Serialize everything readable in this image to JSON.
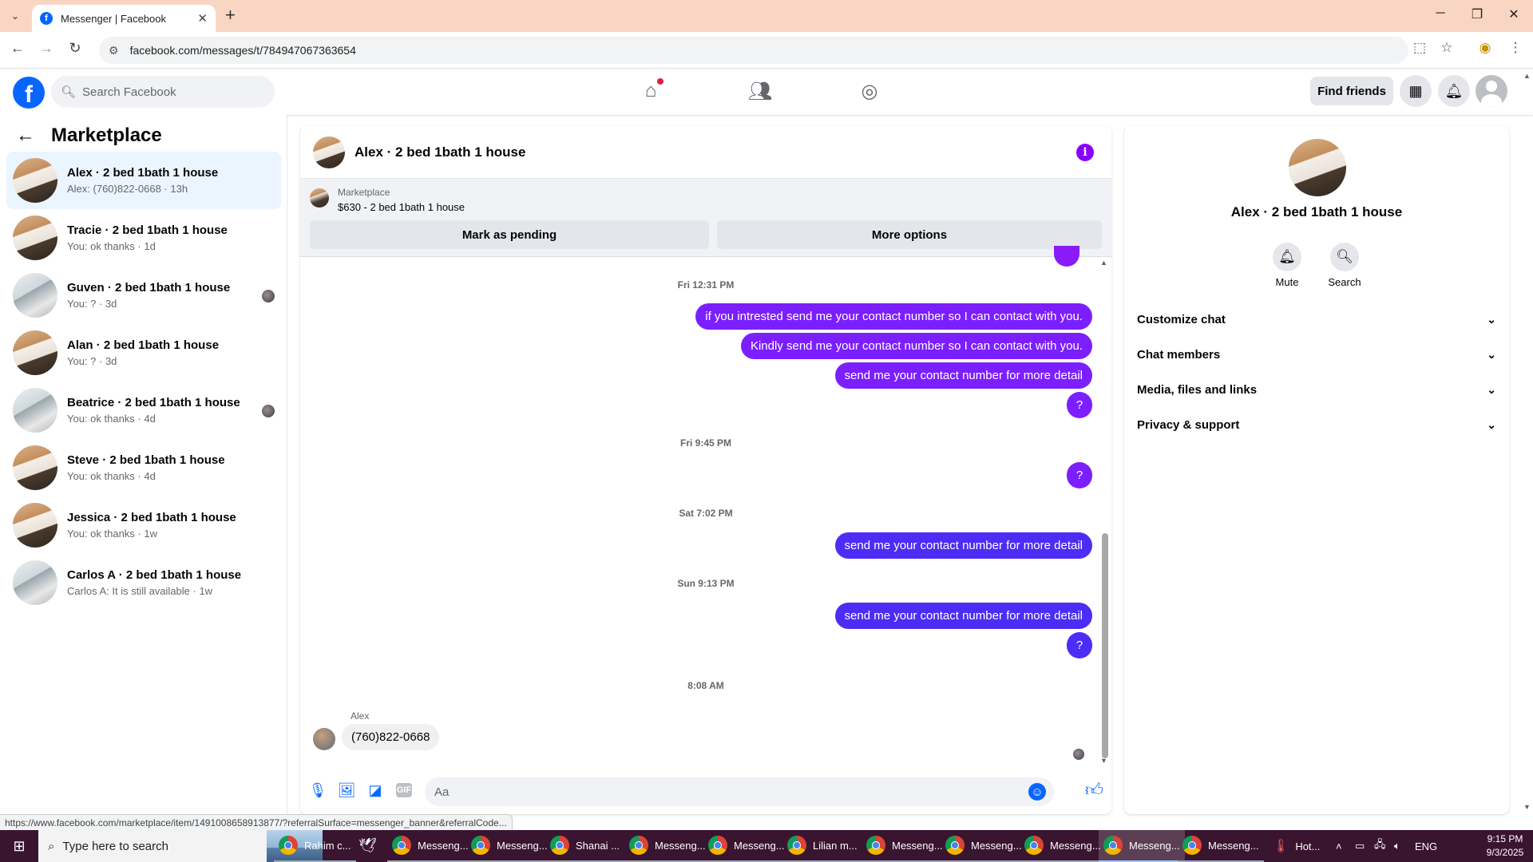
{
  "browser": {
    "tab_title": "Messenger | Facebook",
    "url": "facebook.com/messages/t/784947067363654",
    "status_url": "https://www.facebook.com/marketplace/item/1491008658913877/?referralSurface=messenger_banner&referralCode..."
  },
  "fb_header": {
    "search_placeholder": "Search Facebook",
    "find_friends": "Find friends"
  },
  "sidebar": {
    "title": "Marketplace",
    "conversations": [
      {
        "name": "Alex · 2 bed 1bath 1 house",
        "preview": "Alex: (760)822-0668 · 13h"
      },
      {
        "name": "Tracie · 2 bed 1bath 1 house",
        "preview": "You: ok thanks · 1d"
      },
      {
        "name": "Guven · 2 bed 1bath 1 house",
        "preview": "You: ? · 3d"
      },
      {
        "name": "Alan · 2 bed 1bath 1 house",
        "preview": "You: ? · 3d"
      },
      {
        "name": "Beatrice · 2 bed 1bath 1 house",
        "preview": "You: ok thanks · 4d"
      },
      {
        "name": "Steve · 2 bed 1bath 1 house",
        "preview": "You: ok thanks · 4d"
      },
      {
        "name": "Jessica · 2 bed 1bath 1 house",
        "preview": "You: ok thanks · 1w"
      },
      {
        "name": "Carlos A · 2 bed 1bath 1 house",
        "preview": "Carlos A: It is still available · 1w"
      }
    ]
  },
  "chat": {
    "title": "Alex · 2 bed 1bath 1 house",
    "banner": {
      "label": "Marketplace",
      "listing": "$630 - 2 bed 1bath 1 house",
      "mark_pending": "Mark as pending",
      "more_options": "More options"
    },
    "messages": {
      "ts1": "Fri 12:31 PM",
      "m1": "if you intrested send me your contact number so I can contact with you.",
      "m2": "Kindly send me your contact number so I can contact with you.",
      "m3": "send me your contact number for more detail",
      "m4": "?",
      "ts2": "Fri 9:45 PM",
      "m5": "?",
      "ts3": "Sat 7:02 PM",
      "m6": "send me your contact number for more detail",
      "ts4": "Sun 9:13 PM",
      "m7": "send me your contact number for more detail",
      "m8": "?",
      "ts5": "8:08 AM",
      "sender": "Alex",
      "incoming": "(760)822-0668"
    },
    "composer_placeholder": "Aa"
  },
  "info_panel": {
    "name": "Alex · 2 bed 1bath 1 house",
    "mute": "Mute",
    "search": "Search",
    "sections": [
      "Customize chat",
      "Chat members",
      "Media, files and links",
      "Privacy & support"
    ]
  },
  "taskbar": {
    "search_placeholder": "Type here to search",
    "items": [
      "Rahim c...",
      "Messeng...",
      "Messeng...",
      "Shanai ...",
      "Messeng...",
      "Messeng...",
      "Lilian m...",
      "Messeng...",
      "Messeng...",
      "Messeng...",
      "Messeng...",
      "Messeng..."
    ],
    "weather": "Hot...",
    "lang": "ENG",
    "time": "9:15 PM",
    "date": "9/3/2025"
  },
  "colors": {
    "fb_blue": "#0866ff",
    "bubble_purple": "#7b1fff",
    "bubble_blue": "#4c2df5"
  }
}
